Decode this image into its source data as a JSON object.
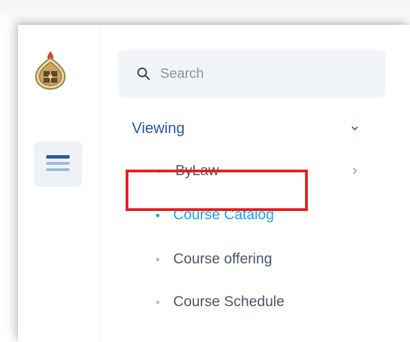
{
  "search": {
    "placeholder": "Search"
  },
  "nav": {
    "group": {
      "title": "Viewing",
      "expanded": true
    },
    "items": [
      {
        "label": "ByLaw",
        "has_submenu": true,
        "active": false
      },
      {
        "label": "Course Catalog",
        "active": true
      },
      {
        "label": "Course offering",
        "active": false
      },
      {
        "label": "Course Schedule",
        "active": false
      }
    ]
  },
  "icons": {
    "logo": "university-seal-icon",
    "menu": "hamburger-menu-icon",
    "search": "search-icon",
    "group_chevron": "chevron-down-icon",
    "item_chevron": "chevron-right-icon"
  },
  "colors": {
    "group_title": "#2b57a6",
    "active_item": "#1aa3f0",
    "item_text": "#4b5563",
    "highlight_border": "#e81d1d",
    "menu_bar_dark": "#2b57a6",
    "menu_bar_light": "#9cb8dc"
  }
}
